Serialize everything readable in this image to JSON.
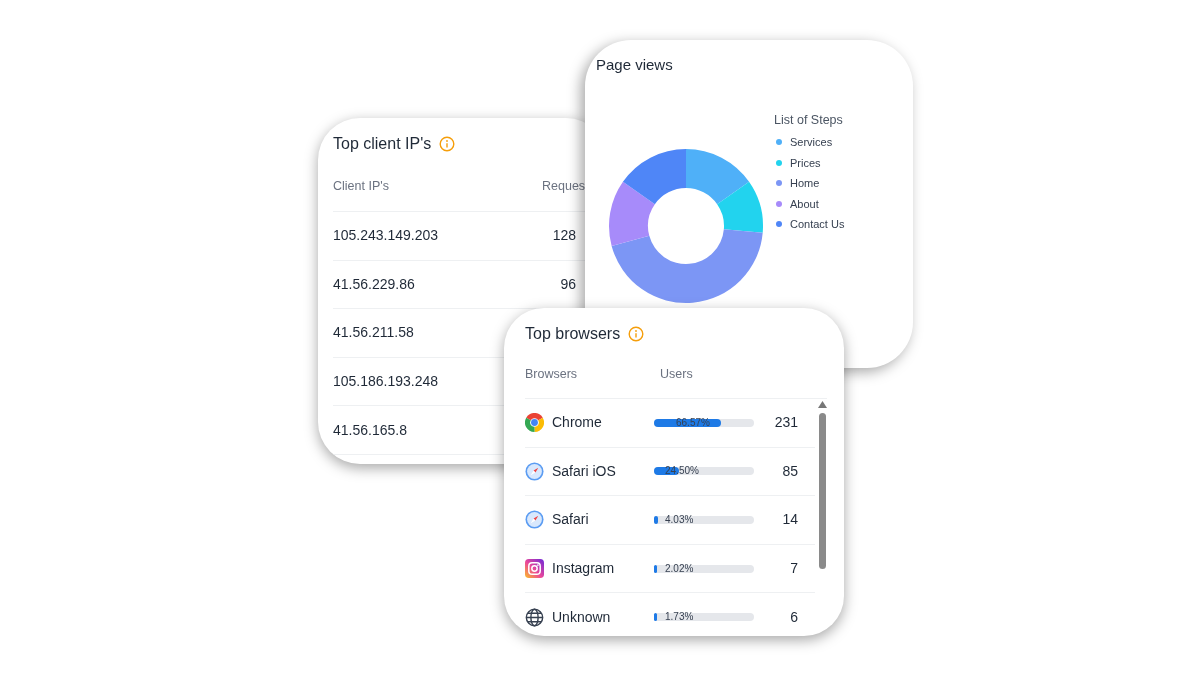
{
  "ip_card": {
    "title": "Top client IP's",
    "columns": [
      "Client IP's",
      "Reques"
    ],
    "rows": [
      {
        "ip": "105.243.149.203",
        "requests": "128"
      },
      {
        "ip": "41.56.229.86",
        "requests": "96"
      },
      {
        "ip": "41.56.211.58"
      },
      {
        "ip": "105.186.193.248"
      },
      {
        "ip": "41.56.165.8"
      }
    ]
  },
  "page_views_card": {
    "title": "Page views",
    "legend_title": "List of Steps",
    "legend": [
      {
        "label": "Services",
        "color": "#4fb0f8"
      },
      {
        "label": "Prices",
        "color": "#22d3ee"
      },
      {
        "label": "Home",
        "color": "#7c96f5"
      },
      {
        "label": "About",
        "color": "#a78bfa"
      },
      {
        "label": "Contact Us",
        "color": "#4f86f7"
      }
    ]
  },
  "browsers_card": {
    "title": "Top browsers",
    "columns": [
      "Browsers",
      "Users"
    ],
    "rows": [
      {
        "kind": "chrome",
        "name": "Chrome",
        "level": 0.6657,
        "percent": "66.57%",
        "users": "231"
      },
      {
        "kind": "safari",
        "name": "Safari iOS",
        "level": 0.245,
        "percent": "24.50%",
        "users": "85"
      },
      {
        "kind": "safari",
        "name": "Safari",
        "level": 0.0403,
        "percent": "4.03%",
        "users": "14"
      },
      {
        "kind": "instagram",
        "name": "Instagram",
        "level": 0.0202,
        "percent": "2.02%",
        "users": "7"
      },
      {
        "kind": "globe",
        "name": "Unknown",
        "level": 0.0173,
        "percent": "1.73%",
        "users": "6"
      }
    ]
  }
}
